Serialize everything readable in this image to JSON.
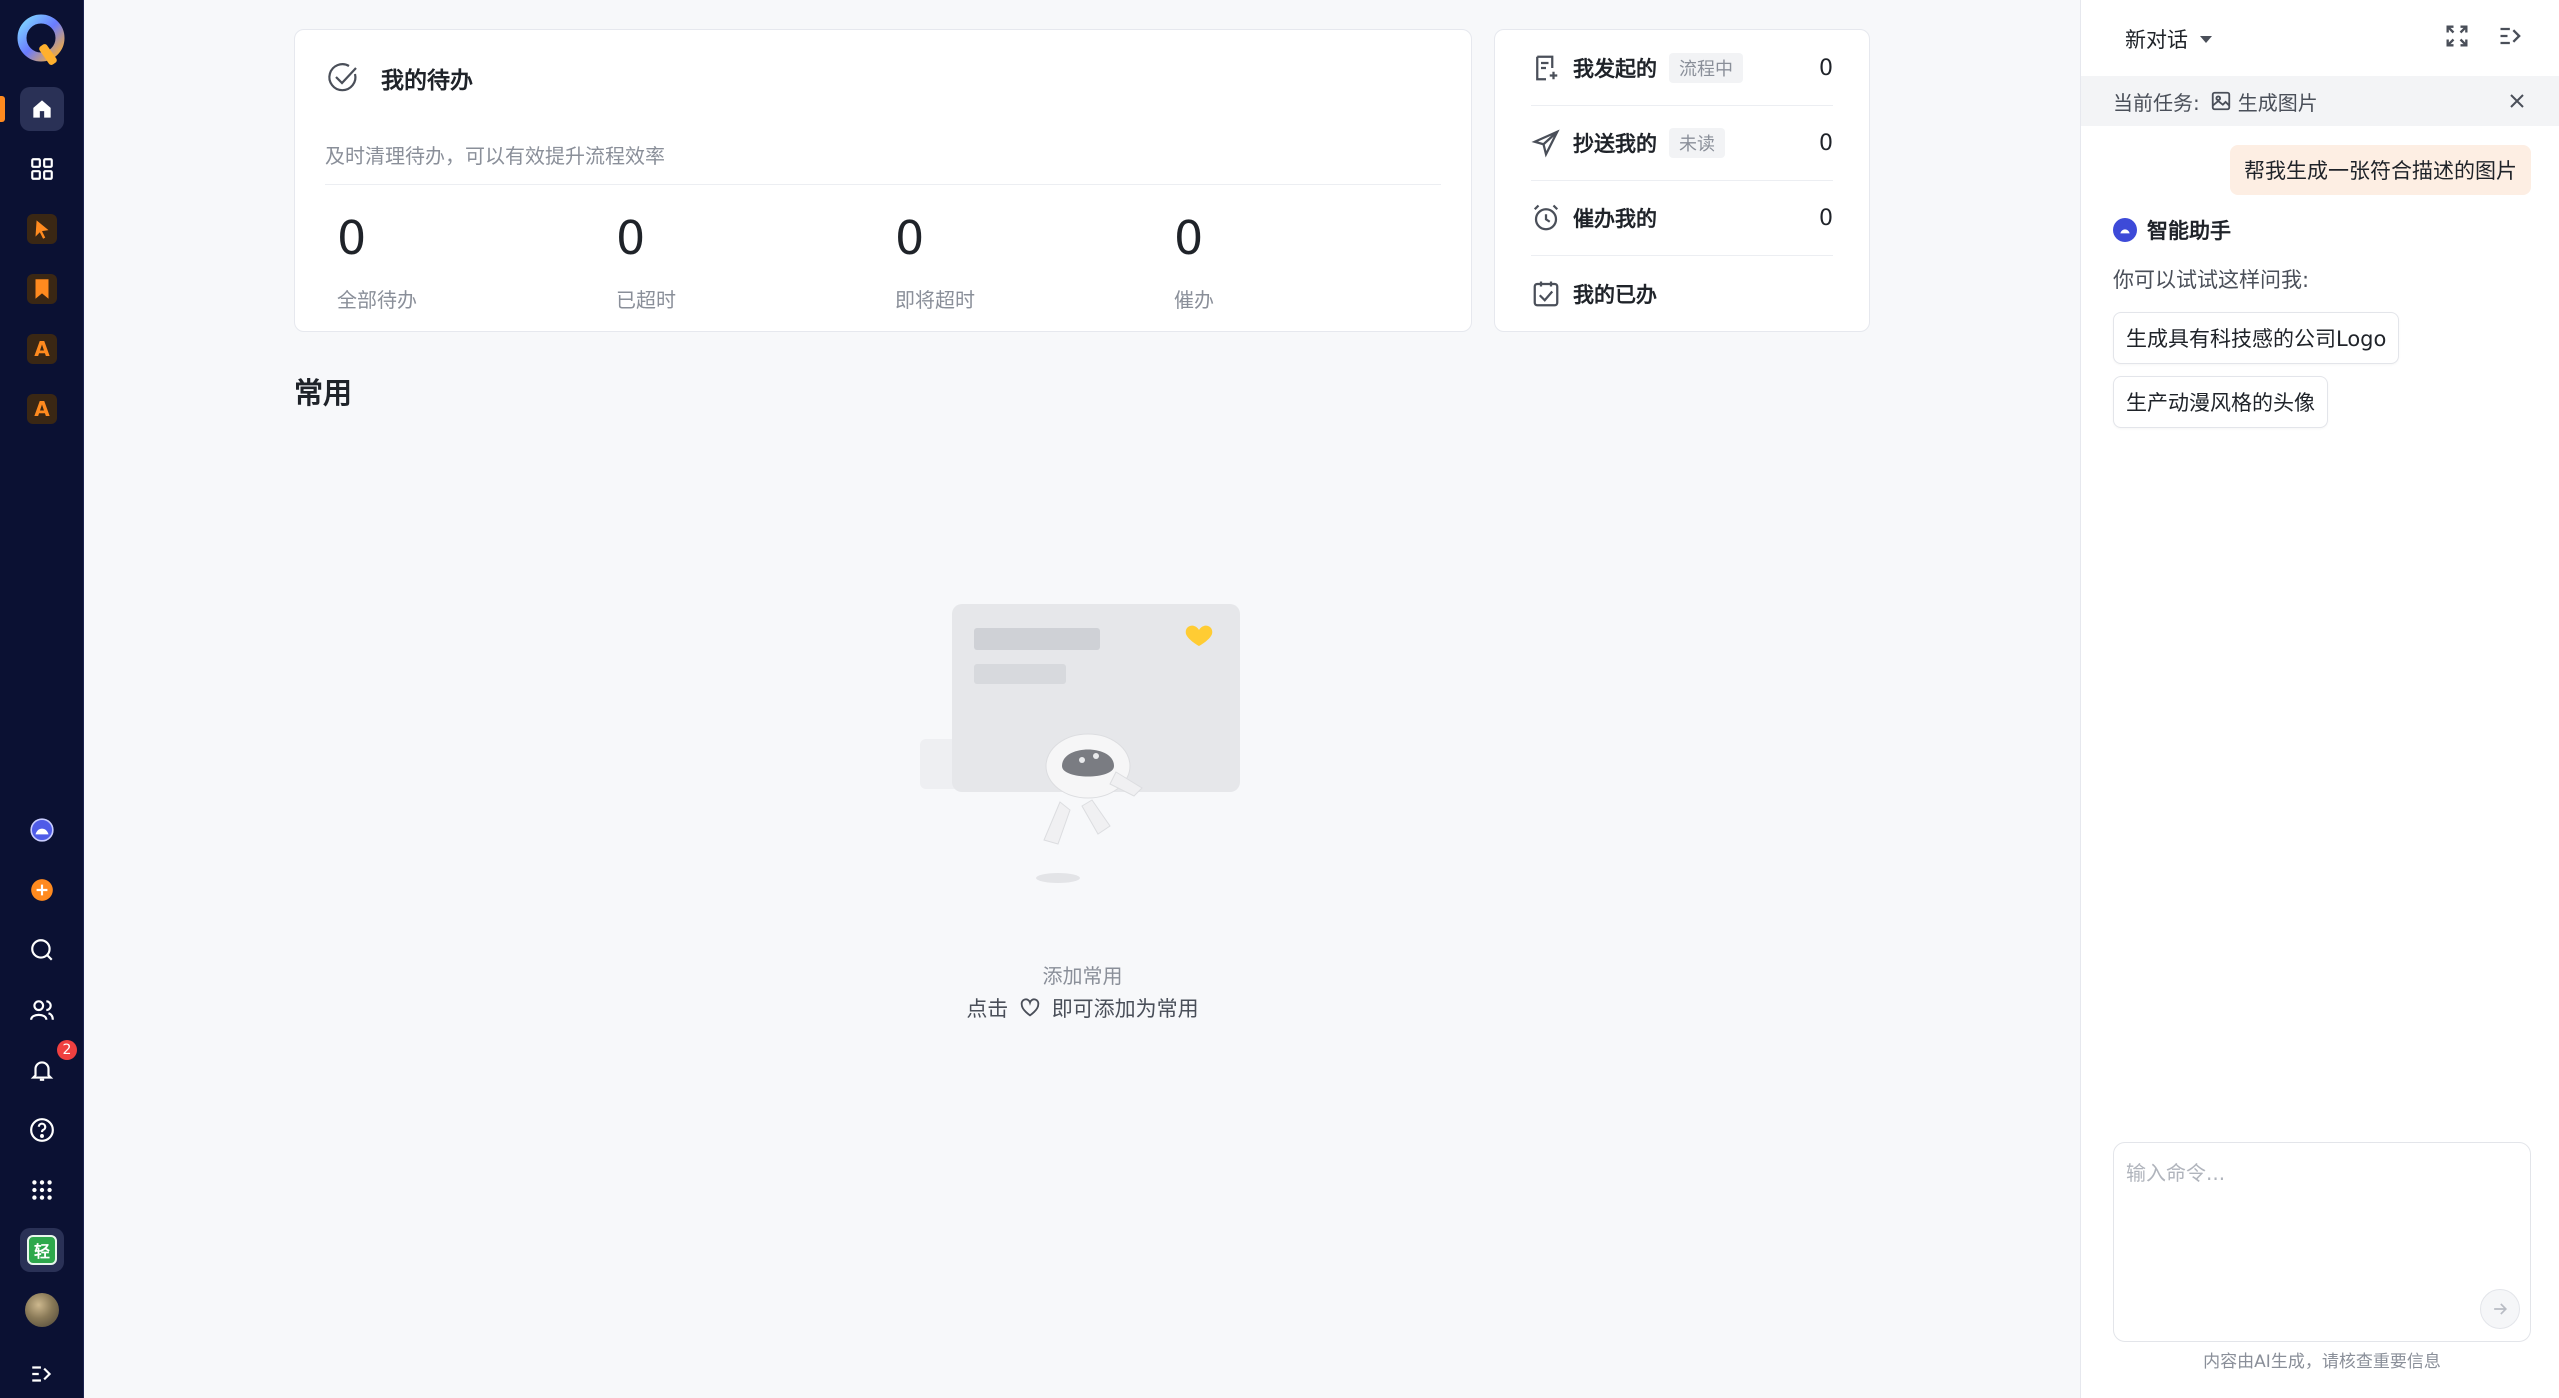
{
  "rail": {
    "items": [
      {
        "name": "home-icon"
      },
      {
        "name": "grid-icon"
      },
      {
        "name": "app-pointer-icon"
      },
      {
        "name": "app-bookmark-icon"
      },
      {
        "name": "app-a-icon",
        "label": "A"
      },
      {
        "name": "app-a-icon",
        "label": "A"
      },
      {
        "name": "assistant-icon"
      },
      {
        "name": "add-icon"
      },
      {
        "name": "search-icon"
      },
      {
        "name": "contacts-icon"
      },
      {
        "name": "bell-icon",
        "badge": "2"
      },
      {
        "name": "help-icon"
      },
      {
        "name": "apps-grid-icon"
      },
      {
        "name": "qing-app-icon",
        "label": "轻"
      },
      {
        "name": "avatar"
      },
      {
        "name": "expand-icon"
      }
    ],
    "accent": "#ff8a1f",
    "notification_badge": "2",
    "qing_label": "轻",
    "a_label": "A"
  },
  "todo": {
    "title": "我的待办",
    "subtitle": "及时清理待办，可以有效提升流程效率",
    "stats": [
      {
        "value": "0",
        "label": "全部待办"
      },
      {
        "value": "0",
        "label": "已超时"
      },
      {
        "value": "0",
        "label": "即将超时"
      },
      {
        "value": "0",
        "label": "催办"
      }
    ]
  },
  "flows": [
    {
      "icon": "document-add-icon",
      "name": "我发起的",
      "tag": "流程中",
      "count": "0"
    },
    {
      "icon": "send-icon",
      "name": "抄送我的",
      "tag": "未读",
      "count": "0"
    },
    {
      "icon": "alarm-icon",
      "name": "催办我的",
      "tag": "",
      "count": "0"
    },
    {
      "icon": "checkbox-icon",
      "name": "我的已办",
      "tag": "",
      "count": ""
    }
  ],
  "common": {
    "title": "常用",
    "empty_title": "添加常用",
    "empty_prefix": "点击",
    "empty_suffix": "即可添加为常用"
  },
  "assistant": {
    "new_chat": "新对话",
    "task_label": "当前任务:",
    "task_name": "生成图片",
    "user_message": "帮我生成一张符合描述的图片",
    "bot_name": "智能助手",
    "hint": "你可以试试这样问我:",
    "suggestions": [
      "生成具有科技感的公司Logo",
      "生产动漫风格的头像"
    ],
    "input_placeholder": "输入命令...",
    "disclaimer": "内容由AI生成，请核查重要信息",
    "bubble_color": "#fdeee3",
    "bot_color": "#3d4ad8"
  }
}
